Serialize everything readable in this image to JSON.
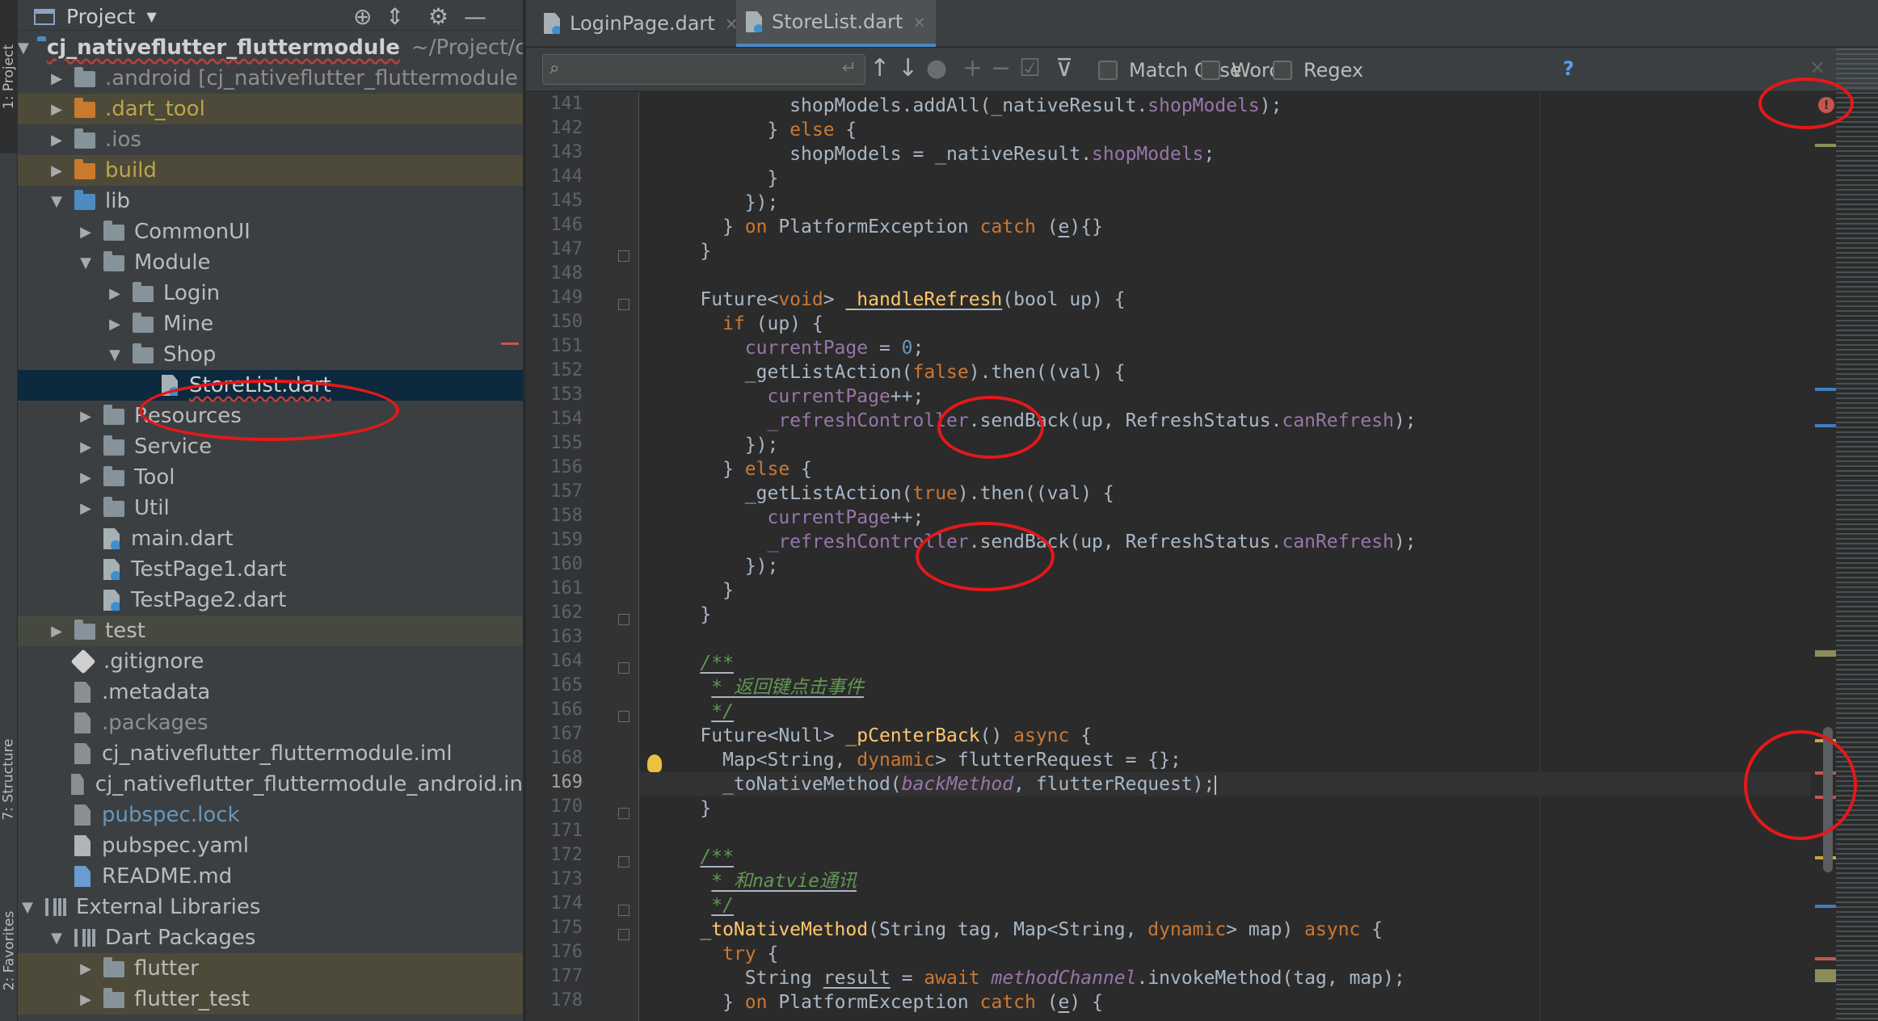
{
  "left_strip": {
    "project_tab": "1: Project",
    "structure_tab": "7: Structure",
    "favorites_tab": "2: Favorites"
  },
  "project_panel": {
    "title": "Project",
    "icons": [
      "crosshair-icon",
      "collapse-icon",
      "gear-icon",
      "minimize-icon"
    ],
    "tree": [
      {
        "name": "cj_nativeflutter_fluttermodule",
        "path": "~/Project/c"
      },
      {
        "name": ".android [cj_nativeflutter_fluttermodule"
      },
      {
        "name": ".dart_tool"
      },
      {
        "name": ".ios"
      },
      {
        "name": "build"
      },
      {
        "name": "lib"
      },
      {
        "name": "CommonUI"
      },
      {
        "name": "Module"
      },
      {
        "name": "Login"
      },
      {
        "name": "Mine"
      },
      {
        "name": "Shop"
      },
      {
        "name": "StoreList.dart"
      },
      {
        "name": "Resources"
      },
      {
        "name": "Service"
      },
      {
        "name": "Tool"
      },
      {
        "name": "Util"
      },
      {
        "name": "main.dart"
      },
      {
        "name": "TestPage1.dart"
      },
      {
        "name": "TestPage2.dart"
      },
      {
        "name": "test"
      },
      {
        "name": ".gitignore"
      },
      {
        "name": ".metadata"
      },
      {
        "name": ".packages"
      },
      {
        "name": "cj_nativeflutter_fluttermodule.iml"
      },
      {
        "name": "cj_nativeflutter_fluttermodule_android.in"
      },
      {
        "name": "pubspec.lock"
      },
      {
        "name": "pubspec.yaml"
      },
      {
        "name": "README.md"
      },
      {
        "name": "External Libraries"
      },
      {
        "name": "Dart Packages"
      },
      {
        "name": "flutter"
      },
      {
        "name": "flutter_test"
      }
    ]
  },
  "editor": {
    "tabs": [
      {
        "label": "LoginPage.dart",
        "close": "×"
      },
      {
        "label": "StoreList.dart",
        "close": "×"
      }
    ],
    "active_tab": "StoreList.dart",
    "find": {
      "query": "",
      "match_case": "Match Case",
      "words": "Words",
      "regex": "Regex",
      "help": "?",
      "close": "×"
    },
    "line_numbers": [
      "141",
      "142",
      "143",
      "144",
      "145",
      "146",
      "147",
      "148",
      "149",
      "150",
      "151",
      "152",
      "153",
      "154",
      "155",
      "156",
      "157",
      "158",
      "159",
      "160",
      "161",
      "162",
      "163",
      "164",
      "165",
      "166",
      "167",
      "168",
      "169",
      "170",
      "171",
      "172",
      "173",
      "174",
      "175",
      "176",
      "177",
      "178"
    ],
    "current_line": "169",
    "error_mark": "!",
    "accent_color": "#4a88c7",
    "annotation_color": "#e5181a"
  }
}
